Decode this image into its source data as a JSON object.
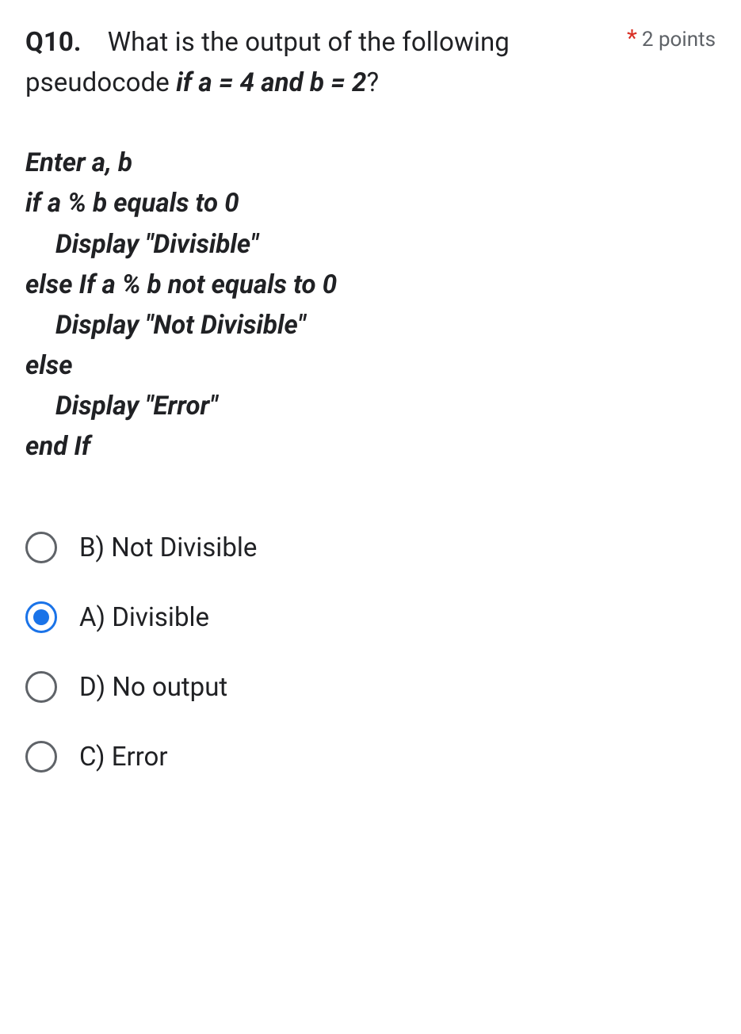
{
  "question": {
    "number": "Q10.",
    "text_part1": "What is the output of the following pseudocode ",
    "text_bold": "if a = 4 and b = 2",
    "text_part2": "?",
    "required_mark": "*",
    "points": "2 points"
  },
  "pseudocode": {
    "line1": "Enter a, b",
    "line2": "if a % b equals to 0",
    "line3": "Display \"Divisible\"",
    "line4": "else If a % b not equals to 0",
    "line5": "Display \"Not Divisible\"",
    "line6": "else",
    "line7": "Display \"Error\"",
    "line8": "end If"
  },
  "options": [
    {
      "label": "B) Not Divisible",
      "selected": false
    },
    {
      "label": "A) Divisible",
      "selected": true
    },
    {
      "label": "D) No output",
      "selected": false
    },
    {
      "label": "C) Error",
      "selected": false
    }
  ]
}
